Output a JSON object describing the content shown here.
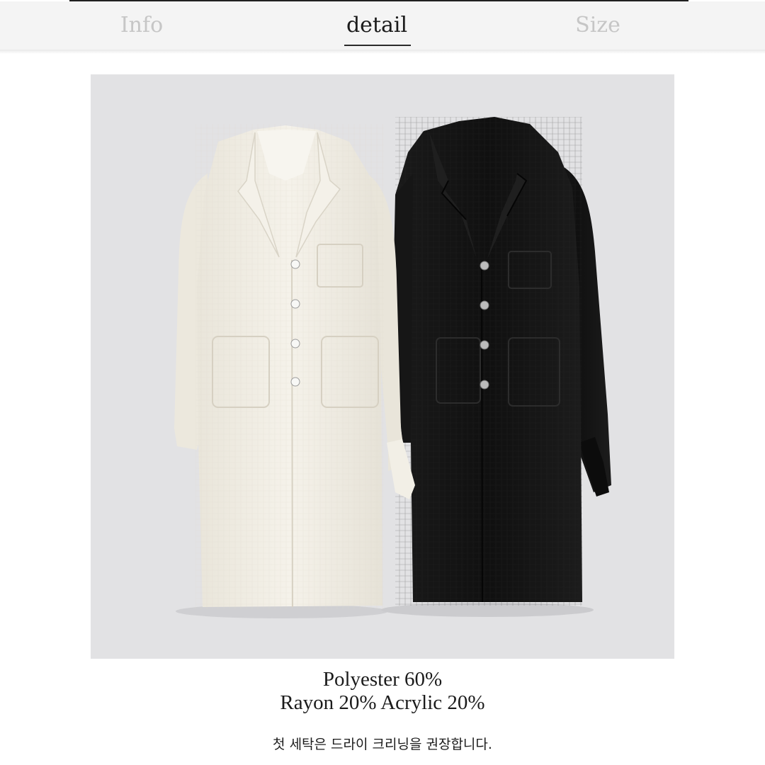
{
  "tabs": [
    {
      "label": "Info",
      "active": false
    },
    {
      "label": "detail",
      "active": true
    },
    {
      "label": "Size",
      "active": false
    }
  ],
  "product_image": {
    "subject": "coat-pair",
    "colors": {
      "background": "#e2e2e4",
      "ivory_coat": "#f1ede3",
      "black_coat": "#121212"
    }
  },
  "fabric": {
    "line1": "Polyester 60%",
    "line2": "Rayon 20% Acrylic 20%"
  },
  "care_note": "첫 세탁은 드라이 크리닝을 권장합니다.",
  "colors": {
    "active_tab": "#1b1b1b",
    "inactive_tab": "#c6c6c6",
    "tabbar_bg": "#f4f4f4"
  }
}
